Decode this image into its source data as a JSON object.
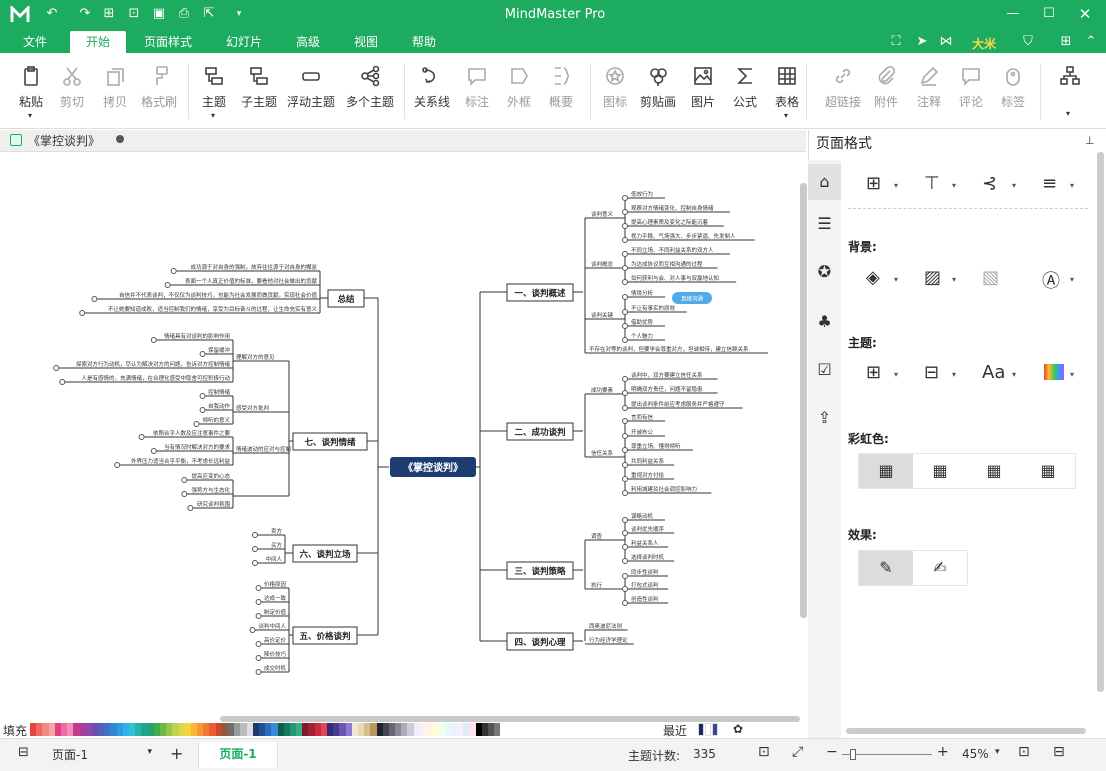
{
  "app": {
    "title": "MindMaster Pro",
    "user": "大米"
  },
  "menu": [
    "文件",
    "开始",
    "页面样式",
    "幻灯片",
    "高级",
    "视图",
    "帮助"
  ],
  "ribbon": {
    "groups": [
      {
        "items": [
          "粘贴",
          "剪切",
          "拷贝",
          "格式刷"
        ]
      },
      {
        "items": [
          "主题",
          "子主题",
          "浮动主题",
          "多个主题"
        ]
      },
      {
        "items": [
          "关系线",
          "标注",
          "外框",
          "概要"
        ]
      },
      {
        "items": [
          "图标",
          "剪贴画",
          "图片",
          "公式",
          "表格"
        ]
      },
      {
        "items": [
          "超链接",
          "附件",
          "注释",
          "评论",
          "标签"
        ]
      }
    ]
  },
  "doc_tab": {
    "name": "《掌控谈判》"
  },
  "mindmap": {
    "center": "《掌控谈判》",
    "right": [
      {
        "title": "一、谈判概述",
        "subs": [
          {
            "label": "谈判意义",
            "leaves": [
              "低效行为",
              "观察对方情绪变化、控制自身情绪",
              "提高心理素质及变化之际能沉着",
              "视力平稳、气场强大、步步紧逼、先发制人"
            ]
          },
          {
            "label": "谈判概念",
            "leaves": [
              "不同立场、不同利益关系的双方人",
              "为达成协议而互相沟通的过程",
              "如何获利与会、对人事与双赢地认知"
            ]
          },
          {
            "label": "谈判关键",
            "leaves": [
              "情境分析",
              "不让有事实的原效",
              "借助优势",
              "个人魅力"
            ]
          },
          {
            "label": "",
            "leaves": [
              "不存在对等的谈判，但要学会尊重对方，坦诚相待，建立信赖关系"
            ]
          }
        ],
        "tag": "直接沟通"
      },
      {
        "title": "二、成功谈判",
        "subs": [
          {
            "label": "成功要素",
            "leaves": [
              "谈判中，双方要建立信任关系",
              "明确双方责任，问题不留隐患",
              "提出谈判条件前应考虑服务并严格遵守"
            ]
          },
          {
            "label": "信任关系",
            "leaves": [
              "言而有信",
              "开诚布公",
              "尊重立场、懂得倾听",
              "共同利益关系",
              "重视对方付给",
              "利用城建及社会调控影响力"
            ]
          }
        ]
      },
      {
        "title": "三、谈判策略",
        "subs": [
          {
            "label": "调查",
            "leaves": [
              "谋略动机",
              "谈判优先顺序",
              "利益关系人",
              "选择谈判时机"
            ]
          },
          {
            "label": "执行",
            "leaves": [
              "同步性谈判",
              "打包式谈判",
              "创造性谈判"
            ]
          }
        ]
      },
      {
        "title": "四、谈判心理",
        "subs": [
          {
            "label": "",
            "leaves": [
              "西奥迪尼法则",
              "行为经济学理论"
            ]
          }
        ]
      }
    ],
    "left": [
      {
        "title": "总结",
        "leaves": [
          "成功源于对自身的强制，放弃往往源于对自身的懈怠",
          "表面一个人真正价值的标准，要看他对社会做出的贡献",
          "自信并不代表谈判，不仅仅为谈判技巧，也能为社会发展而做贡献，实现社会价值",
          "不让她要知道成败，适当控制我们的情绪，享受为目标奋斗的过程，让生命充实有意义"
        ]
      },
      {
        "title": "七、谈判情绪",
        "subs": [
          {
            "label": "理解对方的意见",
            "leaves": [
              "情绪具有对谈判的影响作用",
              "保留缓冲",
              "探索对方行为动机，尽认为解决对方的问题，告诉对方控制情绪",
              "人是有感情的，充满情绪，在合理化感受中取舍可控积极行动"
            ]
          },
          {
            "label": "感受对方批判",
            "leaves": [
              "控制情绪",
              "自我动作",
              "倾听的意义"
            ]
          },
          {
            "label": "情绪波动的应对与控制",
            "leaves": [
              "依照合乎人数及应注意事件之要",
              "当有情况时解决对方的要求",
              "外界压力适当合乎平衡，不考虑长远利益"
            ]
          },
          {
            "label": "",
            "leaves": [
              "提高应变的心态",
              "强势方与生态化",
              "研究谈判氛围"
            ]
          }
        ]
      },
      {
        "title": "六、谈判立场",
        "leaves": [
          "卖方",
          "买方",
          "中间人"
        ]
      },
      {
        "title": "五、价格谈判",
        "leaves": [
          "价格原因",
          "达成一致",
          "制定价值",
          "谈判中间人",
          "高价定价",
          "降价技巧",
          "成交时机"
        ]
      }
    ]
  },
  "panel": {
    "title": "页面格式",
    "background_label": "背景:",
    "theme_label": "主题:",
    "rainbow_label": "彩虹色:",
    "effect_label": "效果:"
  },
  "palette": {
    "fill_label": "填充",
    "recent_label": "最近"
  },
  "status": {
    "page_select": "页面-1",
    "page_tab": "页面-1",
    "topic_count_label": "主题计数:",
    "topic_count": "335",
    "zoom": "45%"
  },
  "colors": {
    "brand": "#1dab5f",
    "center": "#1d3d72",
    "tag": "#52a9e8"
  }
}
